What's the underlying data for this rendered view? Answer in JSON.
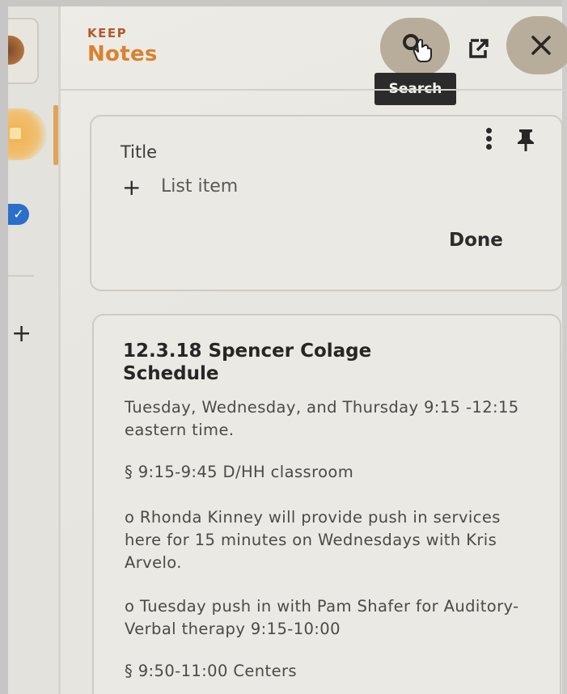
{
  "app": {
    "brand_small": "KEEP",
    "brand_title": "Notes",
    "accent_color": "#d9822f"
  },
  "header": {
    "search_tooltip": "Search",
    "icons": [
      "search-icon",
      "open-in-new-icon",
      "close-icon"
    ]
  },
  "rail": {
    "add_label": "+"
  },
  "new_note": {
    "title_placeholder": "Title",
    "add_icon": "+",
    "list_item_placeholder": "List item",
    "done_label": "Done"
  },
  "note": {
    "title": "12.3.18 Spencer Colage Schedule",
    "lines": [
      "Tuesday, Wednesday, and Thursday 9:15 -12:15 eastern time.",
      "§ 9:15-9:45 D/HH classroom",
      "o  Rhonda Kinney will provide push in services here for 15 minutes on Wednesdays with Kris Arvelo.",
      "o  Tuesday push in with Pam Shafer for Auditory-Verbal therapy 9:15-10:00",
      "§ 9:50-11:00 Centers"
    ]
  }
}
